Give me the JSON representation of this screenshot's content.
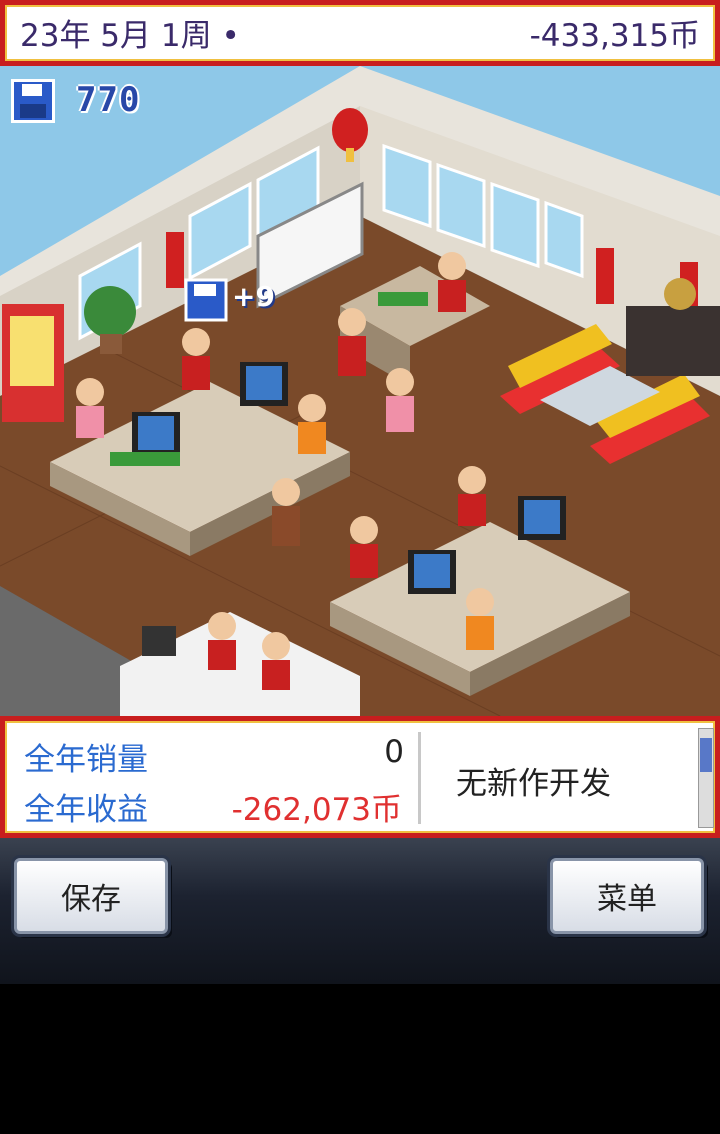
{
  "status_bar": {
    "date": "23年 5月 1周 •",
    "money": "-433,315币"
  },
  "hud": {
    "disk_icon": "floppy-disk-icon",
    "disk_count": "770",
    "floating_gain": "+9"
  },
  "stats": {
    "annual_sales_label": "全年销量",
    "annual_sales_value": "0",
    "annual_revenue_label": "全年收益",
    "annual_revenue_value": "-262,073币",
    "dev_status": "无新作开发"
  },
  "buttons": {
    "save": "保存",
    "menu": "菜单"
  },
  "colors": {
    "frame_red": "#c81e1e",
    "frame_gold": "#f0c040",
    "label_blue": "#2a6ad0",
    "negative_red": "#e03030",
    "floor_brown": "#7a4a2a"
  }
}
